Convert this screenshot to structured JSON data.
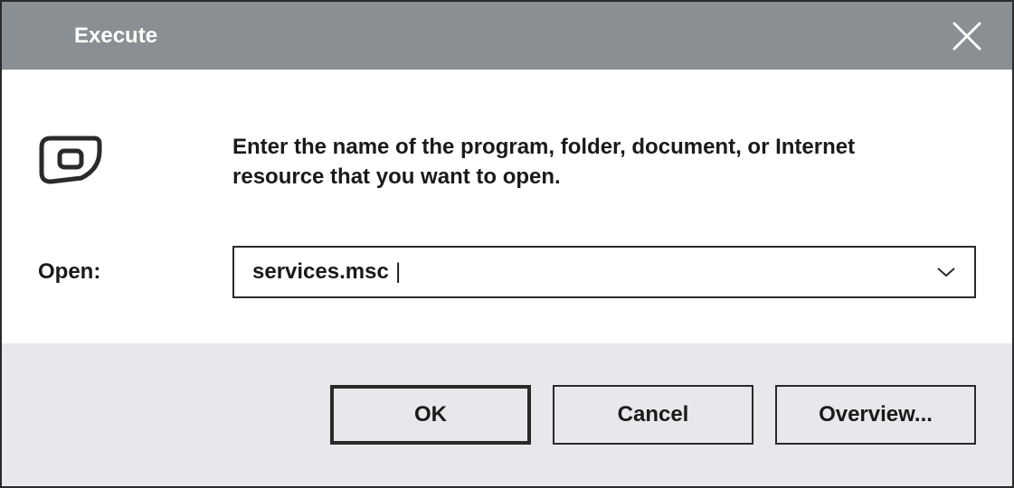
{
  "titlebar": {
    "title": "Execute"
  },
  "content": {
    "instruction": "Enter the name of the program, folder, document, or Internet resource that you want to open.",
    "open_label": "Open:",
    "open_value": "services.msc"
  },
  "buttons": {
    "ok": "OK",
    "cancel": "Cancel",
    "overview": "Overview..."
  }
}
